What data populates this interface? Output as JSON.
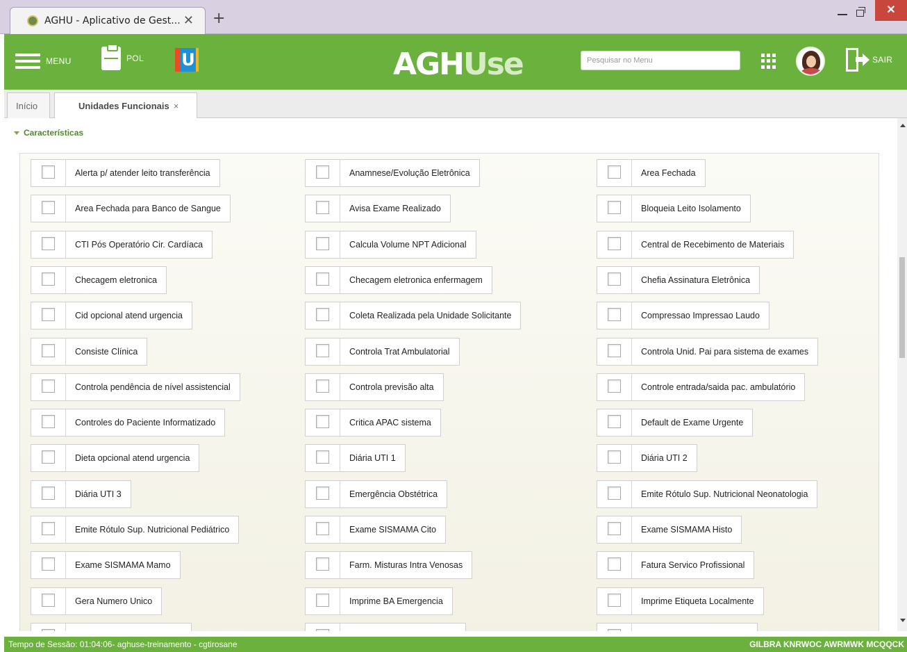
{
  "browser": {
    "tab_title": "AGHU - Aplicativo de Gest...",
    "close_glyph": "✕",
    "new_tab_glyph": "+",
    "window_close_glyph": "✕"
  },
  "header": {
    "menu_label": "MENU",
    "pol_label": "POL",
    "u_logo_text": "U",
    "brand_part1": "AGH",
    "brand_part2": "Use",
    "search_placeholder": "Pesquisar no Menu",
    "exit_label": "SAIR",
    "color": "#6ab23d"
  },
  "tabs": {
    "inicio": "Início",
    "active": "Unidades Funcionais",
    "close_glyph": "×"
  },
  "section": {
    "title": "Características"
  },
  "options": [
    [
      "Alerta p/ atender leito transferência",
      "Anamnese/Evolução Eletrônica",
      "Area Fechada"
    ],
    [
      "Area Fechada para Banco de Sangue",
      "Avisa Exame Realizado",
      "Bloqueia Leito Isolamento"
    ],
    [
      "CTI Pós Operatório Cir. Cardíaca",
      "Calcula Volume NPT Adicional",
      "Central de Recebimento de Materiais"
    ],
    [
      "Checagem eletronica",
      "Checagem eletronica enfermagem",
      "Chefia Assinatura Eletrônica"
    ],
    [
      "Cid opcional atend urgencia",
      "Coleta Realizada pela Unidade Solicitante",
      "Compressao Impressao Laudo"
    ],
    [
      "Consiste Clínica",
      "Controla Trat Ambulatorial",
      "Controla Unid. Pai para sistema de exames"
    ],
    [
      "Controla pendência de nível assistencial",
      "Controla previsão alta",
      "Controle entrada/saida pac. ambulatório"
    ],
    [
      "Controles do Paciente Informatizado",
      "Critica APAC sistema",
      "Default de Exame Urgente"
    ],
    [
      "Dieta opcional atend urgencia",
      "Diária UTI 1",
      "Diária UTI 2"
    ],
    [
      "Diária UTI 3",
      "Emergência Obstétrica",
      "Emite Rótulo Sup. Nutricional Neonatologia"
    ],
    [
      "Emite Rótulo Sup. Nutricional Pediátrico",
      "Exame SISMAMA Cito",
      "Exame SISMAMA Histo"
    ],
    [
      "Exame SISMAMA Mamo",
      "Farm. Misturas Intra Venosas",
      "Fatura Servico Profissional"
    ],
    [
      "Gera Numero Unico",
      "Imprime BA Emergencia",
      "Imprime Etiqueta Localmente"
    ],
    [
      "",
      "",
      ""
    ]
  ],
  "footer": {
    "session": "Tempo de Sessão: 01:04:06- aghuse-treinamento - cgtirosane",
    "right": "GILBRA KNRWOC AWRMWK MCQQCK"
  }
}
